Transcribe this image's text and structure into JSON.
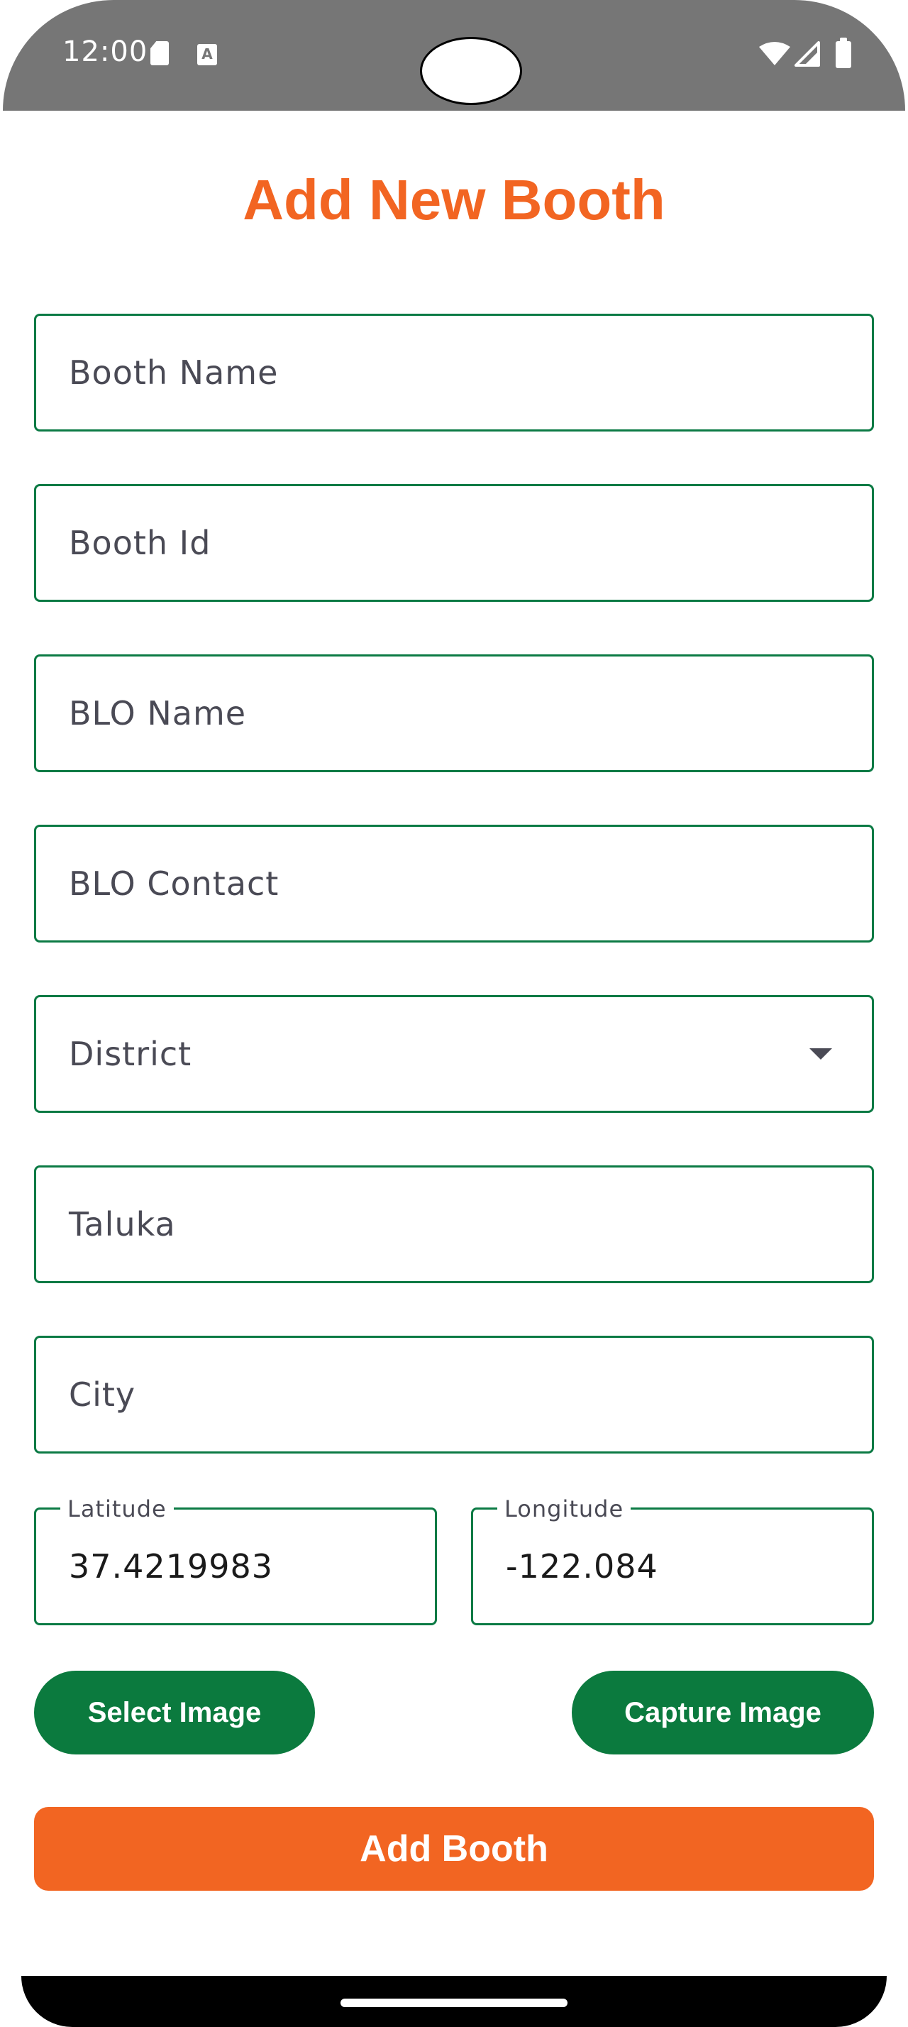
{
  "status_bar": {
    "time": "12:00",
    "icons": [
      "sd-card-icon",
      "keyboard-a-icon",
      "wifi-icon",
      "signal-icon",
      "battery-icon"
    ]
  },
  "page": {
    "title": "Add New Booth"
  },
  "form": {
    "booth_name": {
      "placeholder": "Booth Name"
    },
    "booth_id": {
      "placeholder": "Booth Id"
    },
    "blo_name": {
      "placeholder": "BLO Name"
    },
    "blo_contact": {
      "placeholder": "BLO Contact"
    },
    "district": {
      "placeholder": "District"
    },
    "taluka": {
      "placeholder": "Taluka"
    },
    "city": {
      "placeholder": "City"
    },
    "latitude": {
      "label": "Latitude",
      "value": "37.4219983"
    },
    "longitude": {
      "label": "Longitude",
      "value": "-122.084"
    }
  },
  "buttons": {
    "select_image": "Select Image",
    "capture_image": "Capture Image",
    "add_booth": "Add Booth"
  },
  "colors": {
    "accent_orange": "#f26522",
    "primary_green": "#0b7a3e",
    "field_border": "#0b7a44"
  }
}
